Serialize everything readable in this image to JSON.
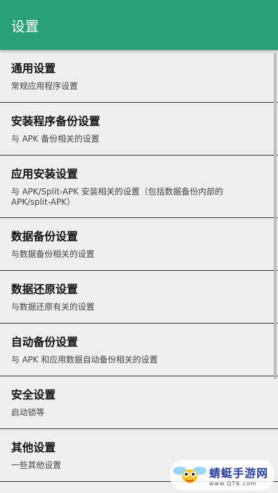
{
  "appbar": {
    "title": "设置"
  },
  "items": [
    {
      "title": "通用设置",
      "subtitle": "常规应用程序设置"
    },
    {
      "title": "安装程序备份设置",
      "subtitle": "与 APK 备份相关的设置"
    },
    {
      "title": "应用安装设置",
      "subtitle": "与 APK/Split-APK 安装相关的设置（包括数据备份内部的 APK/split-APK）"
    },
    {
      "title": "数据备份设置",
      "subtitle": "与数据备份相关的设置"
    },
    {
      "title": "数据还原设置",
      "subtitle": "与数据还原有关的设置"
    },
    {
      "title": "自动备份设置",
      "subtitle": "与 APK 和应用数据自动备份相关的设置"
    },
    {
      "title": "安全设置",
      "subtitle": "启动锁等"
    },
    {
      "title": "其他设置",
      "subtitle": "一些其他设置"
    }
  ],
  "watermark": {
    "name": "蜻蜓手游网",
    "url": "www.QT6.com"
  },
  "colors": {
    "appbar": "#2aa079",
    "background": "#eeeeee",
    "divider": "#333333"
  }
}
